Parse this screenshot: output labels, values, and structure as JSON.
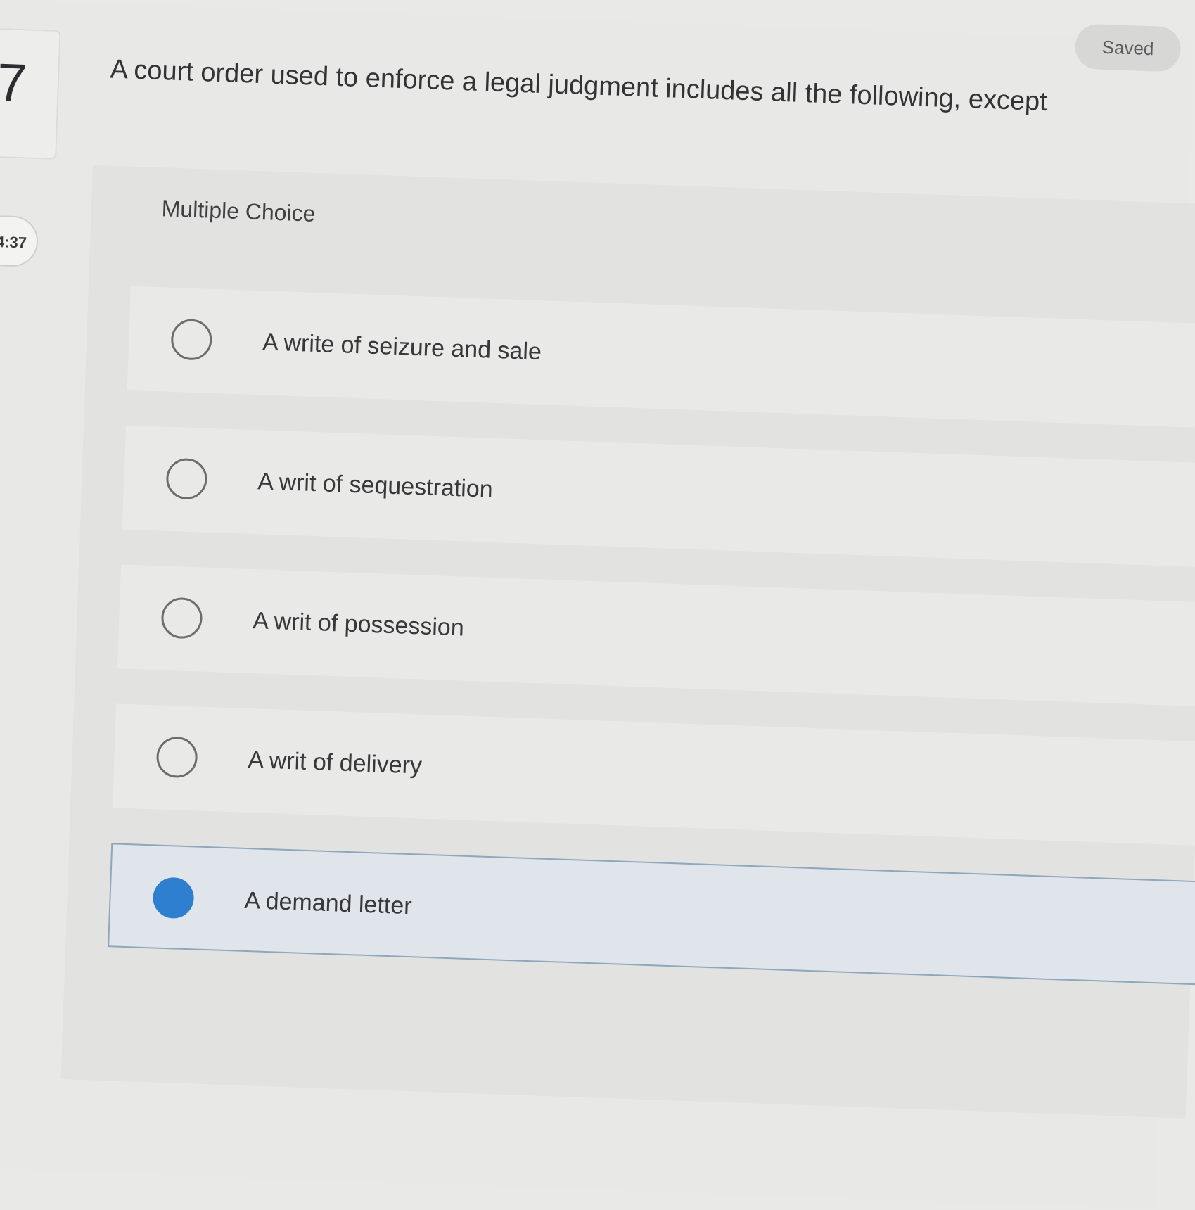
{
  "question": {
    "number": "7",
    "text": "A court order used to enforce a legal judgment includes all the following, except"
  },
  "timer": "4:37",
  "status": "Saved",
  "panel": {
    "label": "Multiple Choice"
  },
  "options": [
    {
      "label": "A write of seizure and sale",
      "selected": false
    },
    {
      "label": "A writ of sequestration",
      "selected": false
    },
    {
      "label": "A writ of possession",
      "selected": false
    },
    {
      "label": "A writ of delivery",
      "selected": false
    },
    {
      "label": "A demand letter",
      "selected": true
    }
  ],
  "colors": {
    "selected_radio": "#2f7fd0",
    "selected_border": "#8fa7bb"
  }
}
